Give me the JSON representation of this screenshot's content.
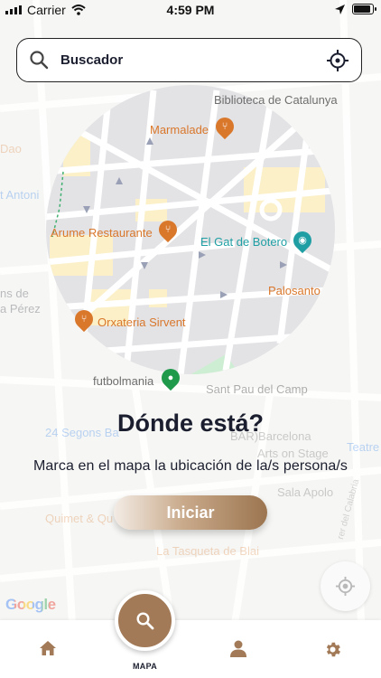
{
  "status_bar": {
    "carrier": "Carrier",
    "time": "4:59 PM",
    "battery_level": 0.9
  },
  "search": {
    "placeholder": "Buscador",
    "icons": [
      "search-icon",
      "crosshair-icon"
    ]
  },
  "map": {
    "labels": {
      "biblioteca": "Biblioteca de Catalunya",
      "marmalade": "Marmalade",
      "arume": "Arume Restaurante",
      "gat_botero": "El Gat de Botero",
      "palosanto": "Palosanto",
      "orxateria": "Orxateria Sirvent",
      "futbolmania": "futbolmania",
      "sant_pau": "Sant Pau del Camp",
      "dao": "Dao",
      "sant_antoni": "t Antoni",
      "ns_de": "ns de",
      "a_perez": "a Pérez",
      "segons": "24 Segons Ba",
      "barcelona": "BAR)Barcelona",
      "arts_stage": "Arts on Stage",
      "teatre": "Teatre",
      "sala_apolo": "Sala Apolo",
      "quimet": "Quimet & Qu",
      "tasqueta": "La Tasqueta de Blai",
      "calabria": "rer del Calabria"
    },
    "attribution": "Google"
  },
  "headline": "Dónde está?",
  "subline": "Marca en el mapa la ubicación de la/s persona/s",
  "start_button": "Iniciar",
  "compass_icon": "compass-icon",
  "tab_bar": {
    "items": [
      {
        "icon": "home-icon"
      },
      {
        "icon": "search-icon",
        "label": "MAPA"
      },
      {
        "icon": "user-icon"
      },
      {
        "icon": "gear-icon"
      }
    ]
  },
  "colors": {
    "accent": "#a27a57",
    "text": "#1b1e2e",
    "poi_orange": "#d9772b",
    "poi_teal": "#1f9fa3"
  }
}
